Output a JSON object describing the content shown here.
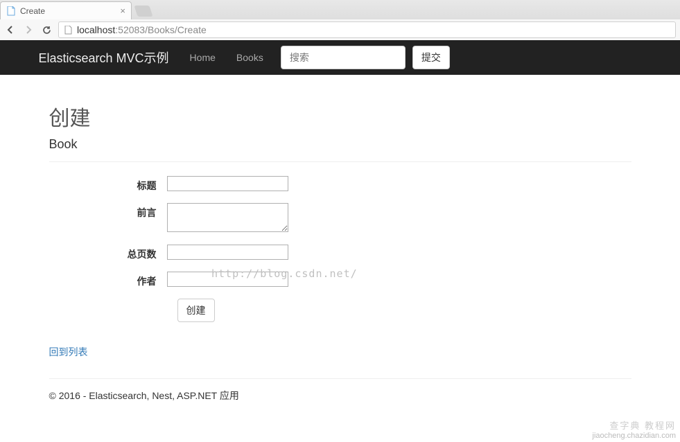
{
  "browser": {
    "tab_title": "Create",
    "url_domain": "localhost",
    "url_rest": ":52083/Books/Create"
  },
  "navbar": {
    "brand": "Elasticsearch MVC示例",
    "links": [
      "Home",
      "Books"
    ],
    "search_placeholder": "搜索",
    "submit_label": "提交"
  },
  "page": {
    "title": "创建",
    "subtitle": "Book",
    "form": {
      "labels": {
        "title": "标题",
        "intro": "前言",
        "pages": "总页数",
        "author": "作者"
      },
      "values": {
        "title": "",
        "intro": "",
        "pages": "",
        "author": ""
      },
      "submit_label": "创建"
    },
    "back_link": "回到列表"
  },
  "footer": {
    "text": "© 2016 - Elasticsearch, Nest, ASP.NET 应用"
  },
  "watermark": "http://blog.csdn.net/",
  "bottom_watermark": {
    "cn": "查字典 教程网",
    "en": "jiaocheng.chazidian.com"
  }
}
